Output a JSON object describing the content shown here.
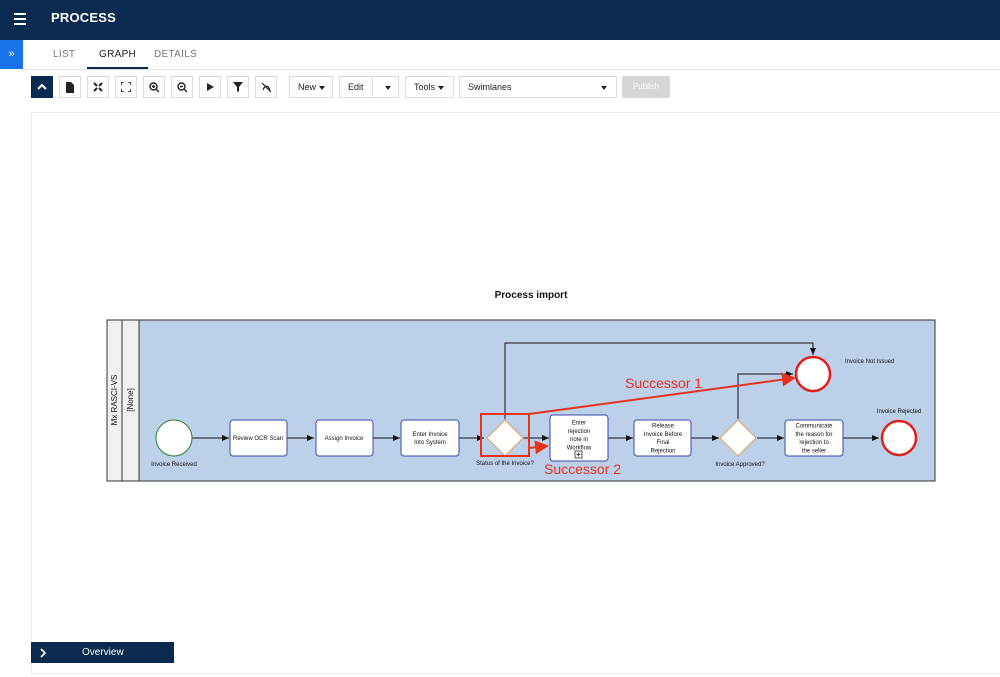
{
  "app": {
    "title": "PROCESS",
    "sidebar_toggle": "»"
  },
  "tabs": [
    {
      "label": "LIST"
    },
    {
      "label": "GRAPH"
    },
    {
      "label": "DETAILS"
    }
  ],
  "toolbar": {
    "icons": [
      "collapse-icon",
      "document-icon",
      "fit-icon",
      "fullscreen-icon",
      "zoom-in-icon",
      "zoom-out-icon",
      "play-icon",
      "filter-icon",
      "hide-icon"
    ],
    "new_label": "New",
    "edit_label": "Edit",
    "tools_label": "Tools",
    "view_select": "Swimlanes",
    "publish_label": "Publish"
  },
  "diagram": {
    "title": "Process import",
    "pool_label": "Mx RASCI-VS",
    "lane_label": "[None]",
    "start_event": "Invoice Received",
    "tasks": {
      "review": "Review OCR Scan",
      "assign": "Assign Invoice",
      "enter": "Enter Invoice Into System",
      "rejection_note": "Enter rejection note in Workflow",
      "release": "Release Invoice Before Final Rejection",
      "communicate": "Communicate the reason for rejection to the seller"
    },
    "gateways": {
      "status": "Status of the Invoice?",
      "approved": "Invoice Approved?"
    },
    "end_events": {
      "not_issued": "Invoice Not Issued",
      "rejected": "Invoice Rejected"
    },
    "annotations": {
      "successor1": "Successor 1",
      "successor2": "Successor 2",
      "color": "#e8321e"
    }
  },
  "overview": {
    "label": "Overview"
  },
  "colors": {
    "header": "#0b2a50",
    "accent": "#1a73e8",
    "lane_fill": "#bcd0ea"
  }
}
